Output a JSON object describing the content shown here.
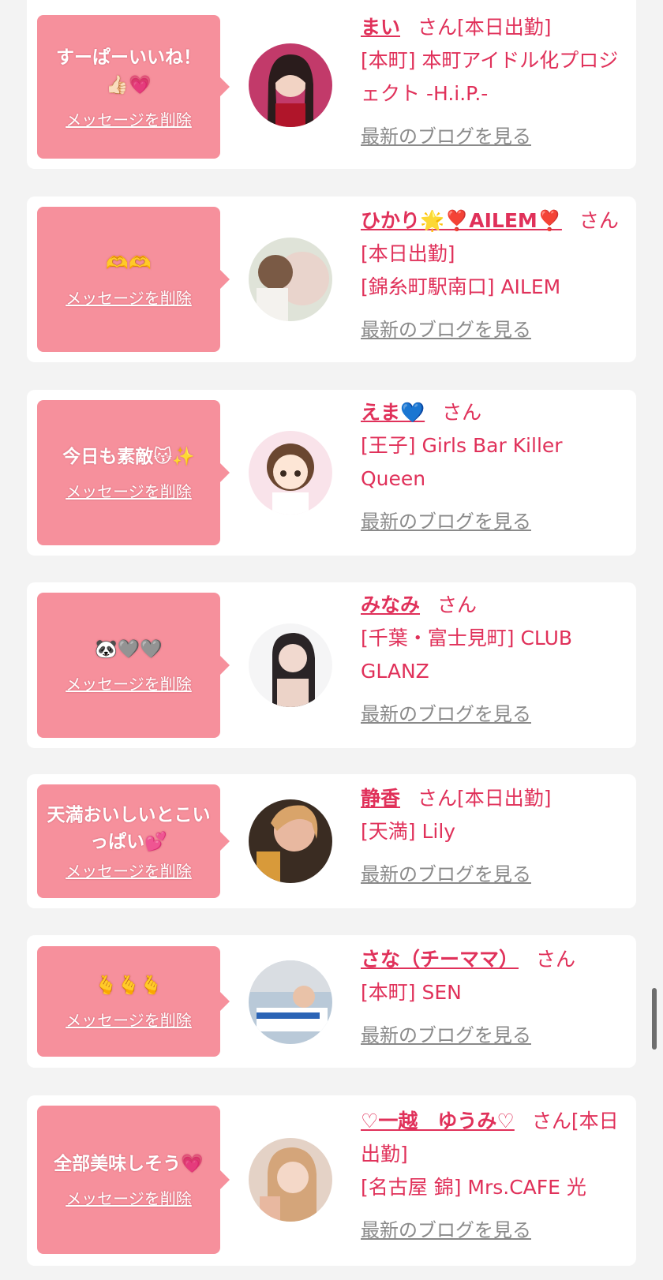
{
  "cards": [
    {
      "message": "すーぱーいいね！👍🏻💗",
      "delete_label": "メッセージを削除",
      "name": "まい",
      "honorific": "さん[本日出勤]",
      "shop": "[本町] 本町アイドル化プロジェクト -H.i.P.-",
      "blog_label": "最新のブログを見る"
    },
    {
      "message": "🫶🫶",
      "delete_label": "メッセージを削除",
      "name": "ひかり🌟❣️AILEM❣️",
      "honorific": "さん[本日出勤]",
      "shop": "[錦糸町駅南口] AILEM",
      "blog_label": "最新のブログを見る"
    },
    {
      "message": "今日も素敵😽✨",
      "delete_label": "メッセージを削除",
      "name": "えま💙",
      "honorific": "さん",
      "shop": "[王子] Girls Bar Killer Queen",
      "blog_label": "最新のブログを見る"
    },
    {
      "message": "🐼🩶🩶",
      "delete_label": "メッセージを削除",
      "name": "みなみ",
      "honorific": "さん",
      "shop": "[千葉・富士見町] CLUB GLANZ",
      "blog_label": "最新のブログを見る"
    },
    {
      "message": "天満おいしいとこいっぱい💕",
      "delete_label": "メッセージを削除",
      "name": "静香",
      "honorific": "さん[本日出勤]",
      "shop": "[天満] Lily",
      "blog_label": "最新のブログを見る"
    },
    {
      "message": "🫰🫰🫰",
      "delete_label": "メッセージを削除",
      "name": "さな（チーママ）",
      "honorific": "さん",
      "shop": "[本町] SEN",
      "blog_label": "最新のブログを見る"
    },
    {
      "message": "全部美味しそう💗",
      "delete_label": "メッセージを削除",
      "name": "♡一越　ゆうみ♡",
      "honorific": "さん[本日出勤]",
      "shop": "[名古屋 錦] Mrs.CAFE 光",
      "blog_label": "最新のブログを見る"
    }
  ],
  "colors": {
    "bubble": "#f6909c",
    "accent": "#e0315a",
    "link_gray": "#8a8a8a",
    "page_bg": "#f3f3f3"
  }
}
